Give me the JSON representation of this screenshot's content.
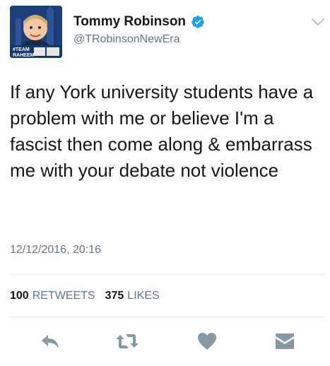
{
  "tweet": {
    "author_name": "Tommy Robinson",
    "author_handle": "@TRobinsonNewEra",
    "text": "If any York university students have a problem with me or believe I'm a fascist then come along & embarrass me with your debate not violence",
    "timestamp": "12/12/2016, 20:16"
  },
  "stats": {
    "retweets_count": "100",
    "retweets_label": "RETWEETS",
    "likes_count": "375",
    "likes_label": "LIKES"
  },
  "avatar": {
    "banner_line1": "#TEAM",
    "banner_line2": "RAHEEM"
  },
  "colors": {
    "text": "#14171a",
    "secondary": "#657786",
    "verified": "#1da1f2",
    "icon": "#8899a6",
    "divider": "#e1e8ed"
  },
  "icons": {
    "verified": "verified-badge-icon",
    "menu": "chevron-down-icon",
    "reply": "reply-icon",
    "retweet": "retweet-icon",
    "like": "heart-icon",
    "dm": "envelope-icon"
  }
}
